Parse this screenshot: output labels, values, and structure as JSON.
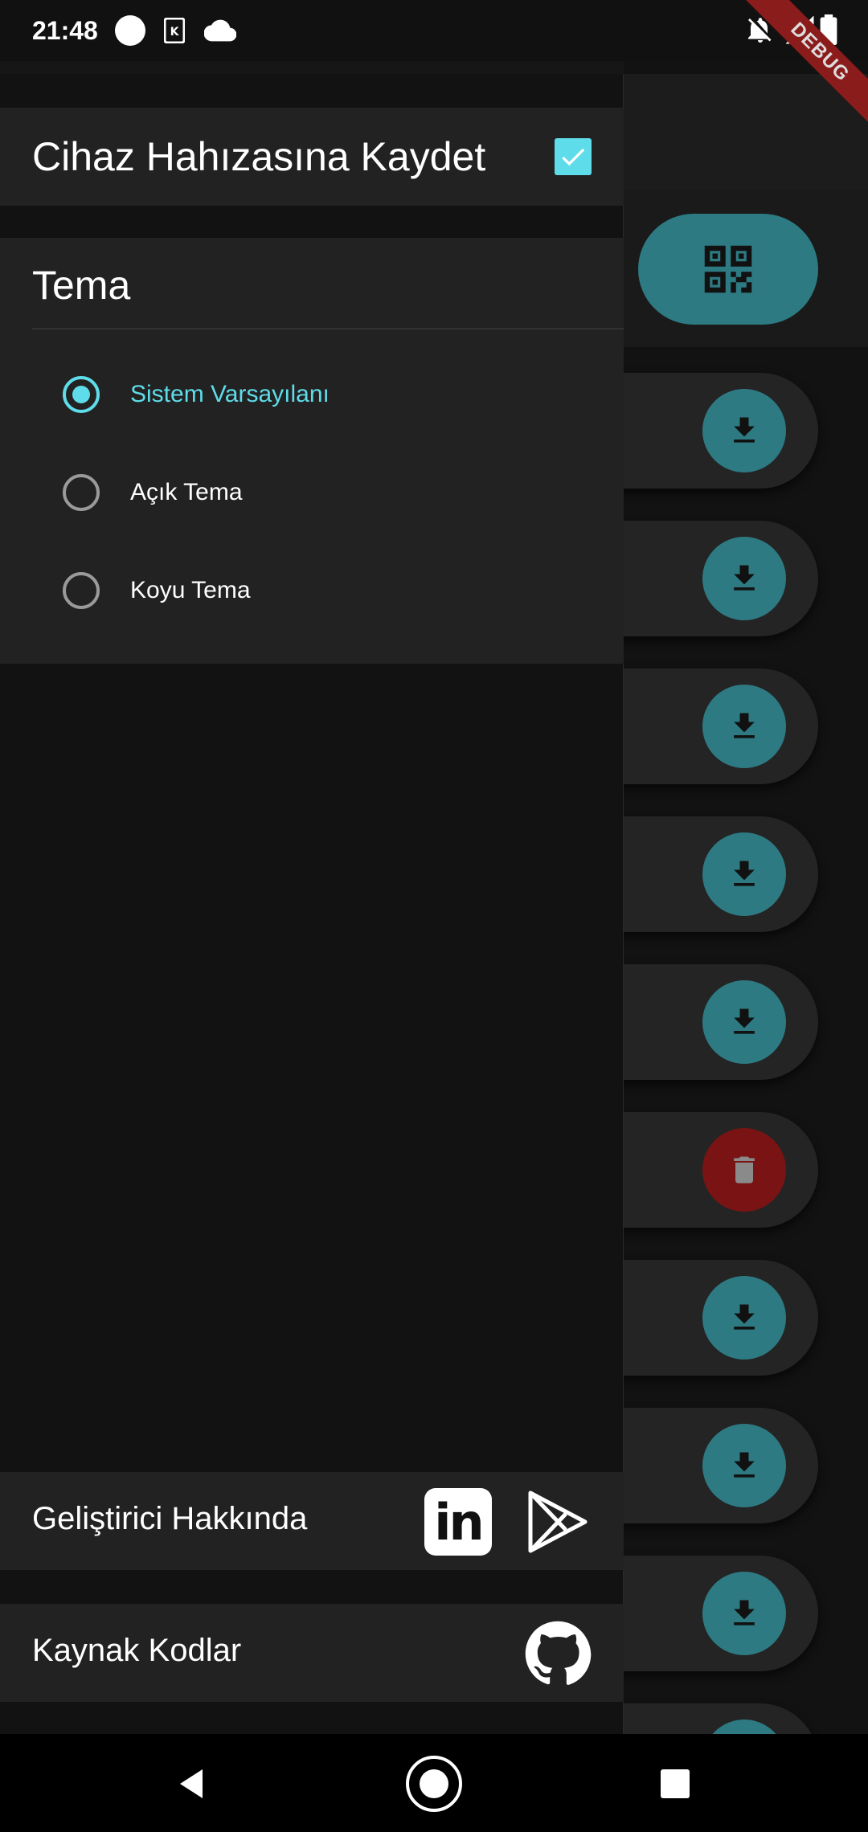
{
  "status_bar": {
    "time": "21:48",
    "icons": [
      "circle-icon",
      "sim-k-icon",
      "cloud-icon",
      "notifications-off-icon",
      "no-signal-icon",
      "battery-icon"
    ]
  },
  "debug_banner": "DEBUG",
  "drawer": {
    "save_to_device_label": "Cihaz Hahızasına Kaydet",
    "save_to_device_checked": true,
    "theme": {
      "title": "Tema",
      "options": [
        {
          "label": "Sistem Varsayılanı",
          "selected": true
        },
        {
          "label": "Açık Tema",
          "selected": false
        },
        {
          "label": "Koyu Tema",
          "selected": false
        }
      ]
    },
    "about_developer_label": "Geliştirici Hakkında",
    "about_icons": [
      "linkedin-icon",
      "google-play-icon"
    ],
    "linkedin_text": "in",
    "source_code_label": "Kaynak Kodlar",
    "source_icon": "github-icon"
  },
  "background_list": {
    "buttons": [
      "download",
      "download",
      "download",
      "download",
      "download",
      "delete",
      "download",
      "download",
      "download"
    ]
  },
  "colors": {
    "accent": "#5fdce9",
    "fab": "#2d7a83",
    "danger": "#7a1414",
    "panel": "#222222",
    "background": "#121212"
  },
  "nav_bar": {
    "buttons": [
      "back-icon",
      "home-icon",
      "recents-icon"
    ]
  }
}
